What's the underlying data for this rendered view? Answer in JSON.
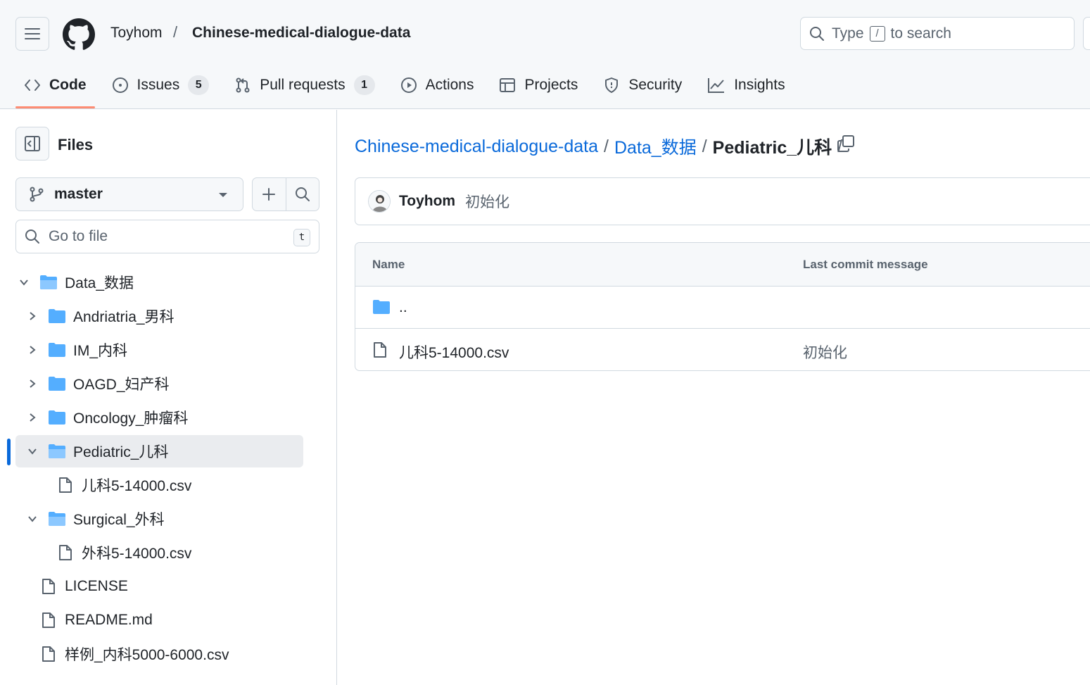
{
  "header": {
    "owner": "Toyhom",
    "separator": "/",
    "repo": "Chinese-medical-dialogue-data",
    "search": {
      "prefix": "Type",
      "key": "/",
      "suffix": "to search"
    }
  },
  "tabs": [
    {
      "label": "Code",
      "icon": "code-icon",
      "active": true
    },
    {
      "label": "Issues",
      "icon": "issue-icon",
      "count": "5"
    },
    {
      "label": "Pull requests",
      "icon": "pull-request-icon",
      "count": "1"
    },
    {
      "label": "Actions",
      "icon": "play-icon"
    },
    {
      "label": "Projects",
      "icon": "table-icon"
    },
    {
      "label": "Security",
      "icon": "shield-icon"
    },
    {
      "label": "Insights",
      "icon": "graph-icon"
    }
  ],
  "sidebar": {
    "title": "Files",
    "branch": "master",
    "goto_placeholder": "Go to file",
    "goto_key": "t",
    "tree": [
      {
        "label": "Data_数据",
        "type": "folder-open",
        "expanded": true
      },
      {
        "label": "Andriatria_男科",
        "type": "folder",
        "expanded": false
      },
      {
        "label": "IM_内科",
        "type": "folder",
        "expanded": false
      },
      {
        "label": "OAGD_妇产科",
        "type": "folder",
        "expanded": false
      },
      {
        "label": "Oncology_肿瘤科",
        "type": "folder",
        "expanded": false
      },
      {
        "label": "Pediatric_儿科",
        "type": "folder-open",
        "expanded": true,
        "selected": true
      },
      {
        "label": "儿科5-14000.csv",
        "type": "file"
      },
      {
        "label": "Surgical_外科",
        "type": "folder-open",
        "expanded": true
      },
      {
        "label": "外科5-14000.csv",
        "type": "file"
      },
      {
        "label": "LICENSE",
        "type": "file"
      },
      {
        "label": "README.md",
        "type": "file"
      },
      {
        "label": "样例_内科5000-6000.csv",
        "type": "file"
      }
    ]
  },
  "main": {
    "breadcrumb": [
      {
        "label": "Chinese-medical-dialogue-data",
        "link": true
      },
      {
        "label": "Data_数据",
        "link": true
      },
      {
        "label": "Pediatric_儿科",
        "link": false
      }
    ],
    "breadcrumb_sep": "/",
    "commit": {
      "author": "Toyhom",
      "message": "初始化"
    },
    "table": {
      "headers": {
        "name": "Name",
        "message": "Last commit message"
      },
      "rows": [
        {
          "name": "..",
          "type": "folder",
          "message": ""
        },
        {
          "name": "儿科5-14000.csv",
          "type": "file",
          "message": "初始化"
        }
      ]
    }
  },
  "colors": {
    "link": "#0969da",
    "active_tab": "#fd8c73",
    "folder": "#54aeff",
    "muted": "#59636e"
  }
}
